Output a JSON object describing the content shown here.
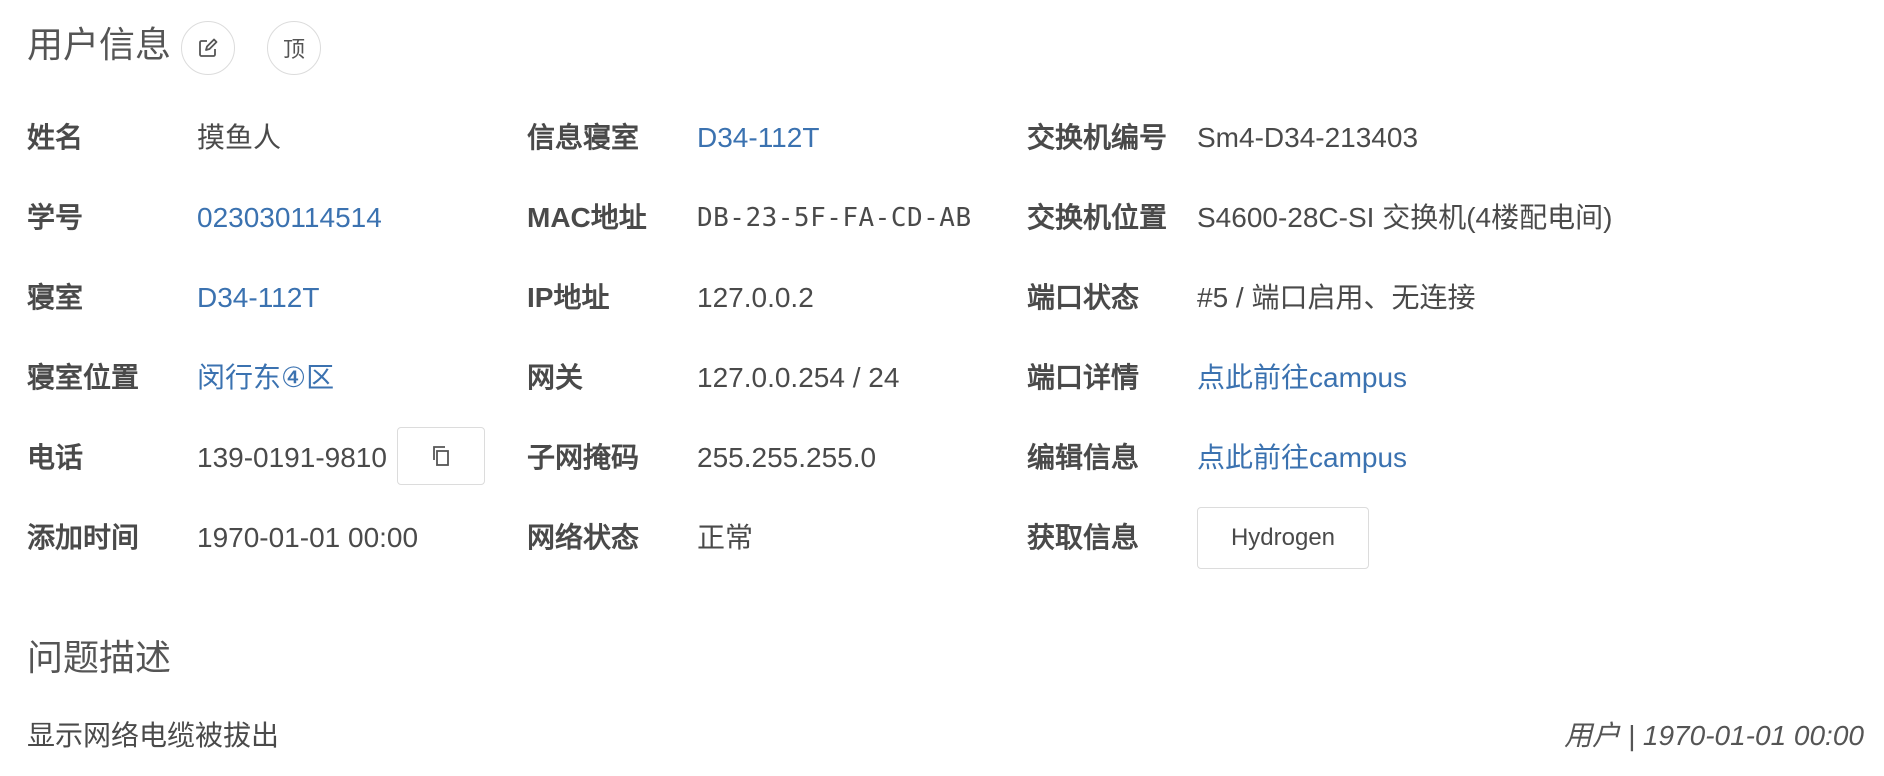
{
  "header": {
    "title": "用户信息",
    "edit_icon": "edit-icon",
    "pin_label": "顶"
  },
  "col1": {
    "name_label": "姓名",
    "name_value": "摸鱼人",
    "student_id_label": "学号",
    "student_id_value": "023030114514",
    "dorm_label": "寝室",
    "dorm_value": "D34-112T",
    "dorm_location_label": "寝室位置",
    "dorm_location_value": "闵行东④区",
    "phone_label": "电话",
    "phone_value": "139-0191-9810",
    "copy_icon": "copy-icon",
    "added_time_label": "添加时间",
    "added_time_value": "1970-01-01 00:00"
  },
  "col2": {
    "info_dorm_label": "信息寝室",
    "info_dorm_value": "D34-112T",
    "mac_label": "MAC地址",
    "mac_value": "DB-23-5F-FA-CD-AB",
    "ip_label": "IP地址",
    "ip_value": "127.0.0.2",
    "gateway_label": "网关",
    "gateway_value": "127.0.0.254 / 24",
    "subnet_label": "子网掩码",
    "subnet_value": "255.255.255.0",
    "net_status_label": "网络状态",
    "net_status_value": "正常"
  },
  "col3": {
    "switch_id_label": "交换机编号",
    "switch_id_value": "Sm4-D34-213403",
    "switch_location_label": "交换机位置",
    "switch_location_value": "S4600-28C-SI 交换机(4楼配电间)",
    "port_status_label": "端口状态",
    "port_status_value": "#5 / 端口启用、无连接",
    "port_detail_label": "端口详情",
    "port_detail_value": "点此前往campus",
    "edit_info_label": "编辑信息",
    "edit_info_value": "点此前往campus",
    "fetch_info_label": "获取信息",
    "fetch_button": "Hydrogen"
  },
  "problem": {
    "title": "问题描述",
    "text": "显示网络电缆被拔出",
    "meta": "用户 | 1970-01-01 00:00"
  },
  "colors": {
    "link": "#3b72b0",
    "text": "#4a4a4a",
    "border": "#dcdcdc"
  }
}
